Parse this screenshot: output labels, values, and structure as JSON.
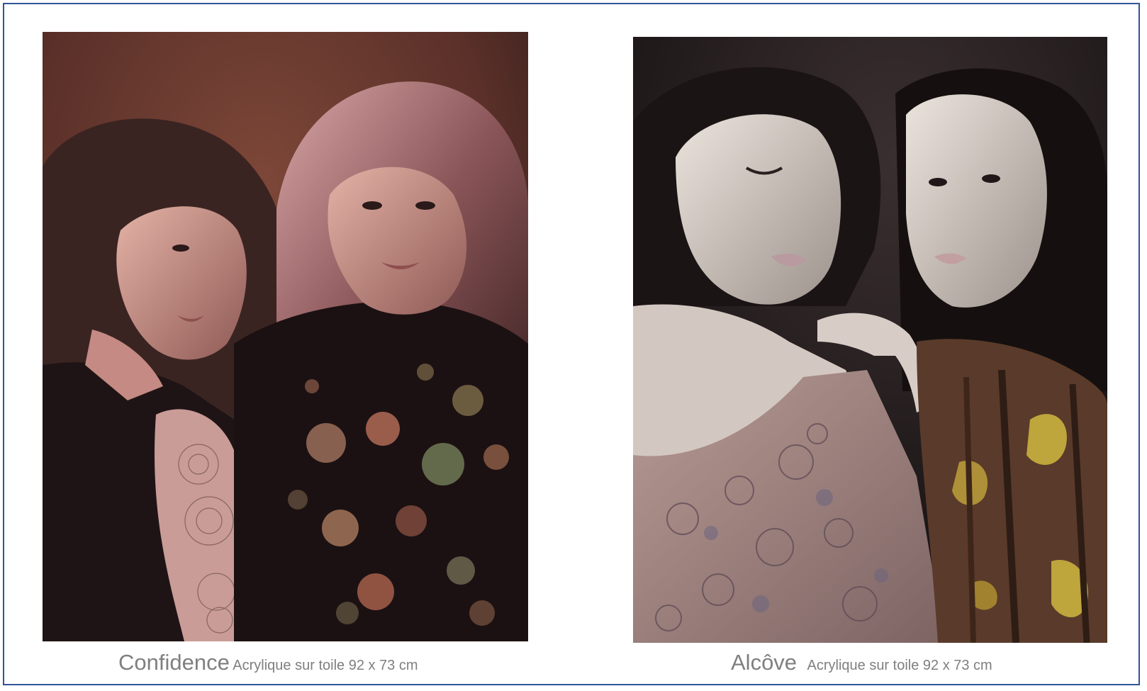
{
  "artworks": [
    {
      "title": "Confidence",
      "medium": "Acrylique sur toile 92 x 73 cm",
      "colors": {
        "background": "#6b3a31",
        "shadow": "#1c1112",
        "skin": "#c98f86",
        "hair": "#3a2422"
      }
    },
    {
      "title": "Alcôve",
      "medium": "Acrylique sur toile 92 x 73 cm",
      "colors": {
        "background": "#1d1718",
        "skin": "#d9cfc8",
        "dress": "#a58783",
        "pattern": "#c9b13f"
      }
    }
  ],
  "frame": {
    "border_color": "#2f5597"
  },
  "caption_color": "#7f7f7f"
}
